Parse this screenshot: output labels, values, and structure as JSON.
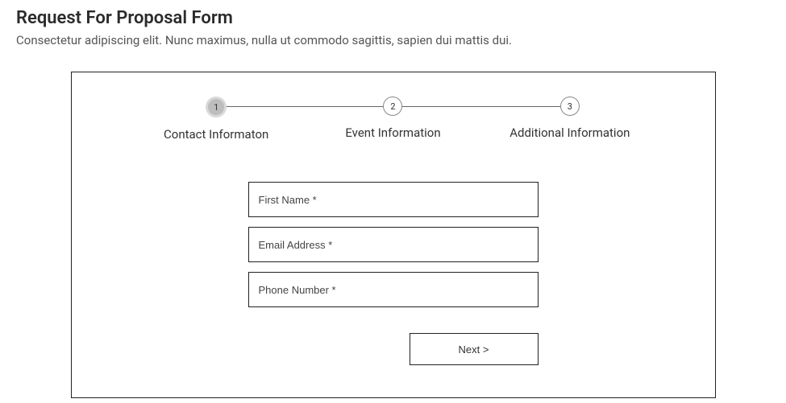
{
  "header": {
    "title": "Request For Proposal Form",
    "description": "Consectetur adipiscing elit. Nunc maximus, nulla ut commodo sagittis, sapien dui mattis dui."
  },
  "stepper": {
    "steps": [
      {
        "number": "1",
        "label": "Contact Informaton"
      },
      {
        "number": "2",
        "label": "Event Information"
      },
      {
        "number": "3",
        "label": "Additional Information"
      }
    ]
  },
  "form": {
    "fields": {
      "first_name": {
        "placeholder": "First Name *",
        "value": ""
      },
      "email": {
        "placeholder": "Email Address *",
        "value": ""
      },
      "phone": {
        "placeholder": "Phone Number *",
        "value": ""
      }
    },
    "next_label": "Next >"
  }
}
